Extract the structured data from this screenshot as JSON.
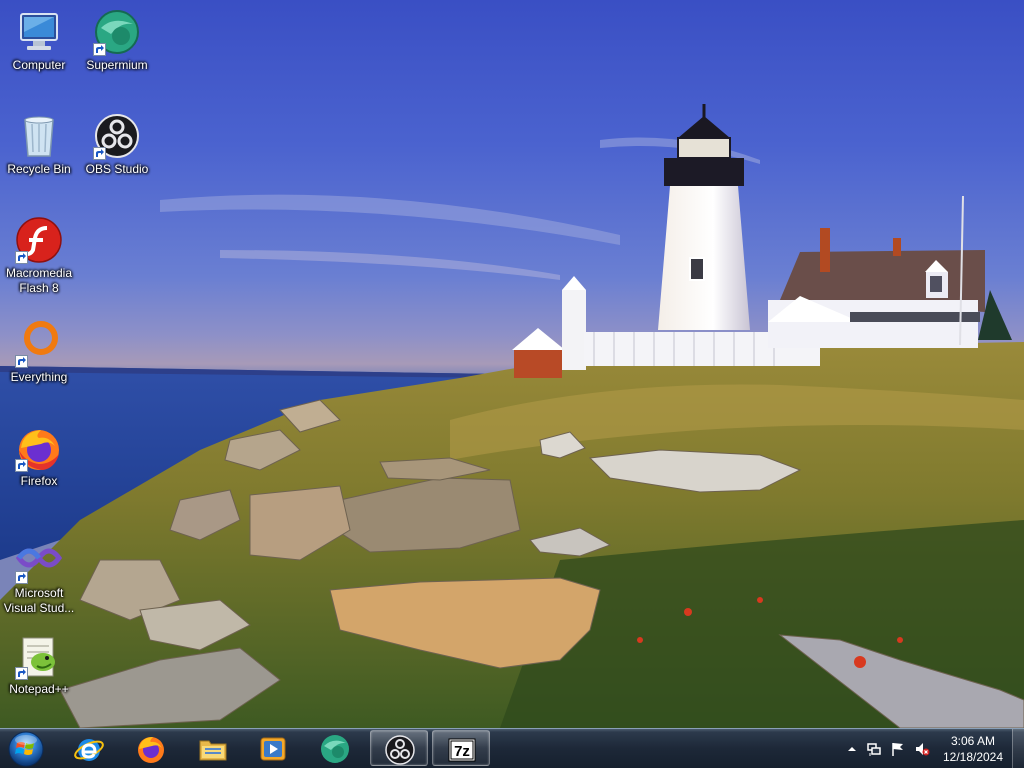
{
  "desktop": {
    "icons": [
      {
        "label": "Computer",
        "icon": "computer-icon"
      },
      {
        "label": "Supermium",
        "icon": "supermium-icon"
      },
      {
        "label": "Recycle Bin",
        "icon": "recycle-bin-icon"
      },
      {
        "label": "OBS Studio",
        "icon": "obs-studio-icon"
      },
      {
        "label": "Macromedia Flash 8",
        "icon": "flash-icon"
      },
      {
        "label": "Everything",
        "icon": "everything-icon"
      },
      {
        "label": "Firefox",
        "icon": "firefox-icon"
      },
      {
        "label": "Microsoft Visual Stud...",
        "icon": "visual-studio-icon"
      },
      {
        "label": "Notepad++",
        "icon": "notepadpp-icon"
      }
    ]
  },
  "taskbar": {
    "start_label": "Start",
    "pinned": [
      {
        "name": "Internet Explorer",
        "icon": "internet-explorer-icon"
      },
      {
        "name": "Firefox",
        "icon": "firefox-icon"
      },
      {
        "name": "Windows Explorer",
        "icon": "folder-icon"
      },
      {
        "name": "Windows Media Player",
        "icon": "media-player-icon"
      },
      {
        "name": "Supermium",
        "icon": "supermium-icon"
      },
      {
        "name": "OBS Studio",
        "icon": "obs-studio-icon",
        "active": true
      },
      {
        "name": "7-Zip",
        "icon": "7zip-icon",
        "active": true,
        "text": "7z"
      }
    ],
    "tray": {
      "icons": [
        "show-hidden-icons-arrow",
        "network-icon",
        "action-center-flag-icon",
        "volume-muted-icon"
      ],
      "time": "3:06 AM",
      "date": "12/18/2024"
    }
  },
  "colors": {
    "sky": "#3a4fc4",
    "taskbar": "#1d2838",
    "accent": "#4a8ae8"
  }
}
